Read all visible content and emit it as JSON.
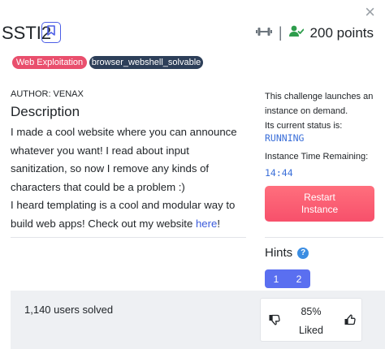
{
  "header": {
    "close_symbol": "×",
    "title": "SSTI2",
    "separator": "|",
    "points": "200 points",
    "icons": {
      "bookmark": "bookmark-icon",
      "difficulty": "dumbbell-icon",
      "solved": "user-check-icon"
    },
    "colors": {
      "accent": "#4c5ee6",
      "solved_icon": "#2e9d4c"
    }
  },
  "tags": [
    {
      "label": "Web Exploitation",
      "color": "#e94f6d"
    },
    {
      "label": "browser_webshell_solvable",
      "color": "#2d3f59"
    }
  ],
  "description": {
    "author": "AUTHOR: VENAX",
    "heading": "Description",
    "paragraph_1": "I made a cool website where you can announce whatever you want! I read about input sanitization, so now I remove any kinds of characters that could be a problem :)",
    "paragraph_2_prefix": "I heard templating is a cool and modular way to build web apps! Check out my website ",
    "link_text": "here",
    "paragraph_2_suffix": "!"
  },
  "instance": {
    "launch_text": "This challenge launches an instance on demand.",
    "status_label": "Its current status is:",
    "status": "RUNNING",
    "time_label": "Instance Time Remaining:",
    "time_remaining": "14:44",
    "restart_line1": "Restart",
    "restart_line2": "Instance",
    "restart_color": "#f7506b"
  },
  "hints": {
    "title": "Hints",
    "help_symbol": "?",
    "items": [
      "1",
      "2"
    ],
    "color": "#5a6ff0"
  },
  "footer": {
    "solved": "1,140 users solved",
    "liked_percent": "85%",
    "liked_label": "Liked",
    "icons": {
      "dislike": "thumbs-down-icon",
      "like": "thumbs-up-icon"
    }
  }
}
